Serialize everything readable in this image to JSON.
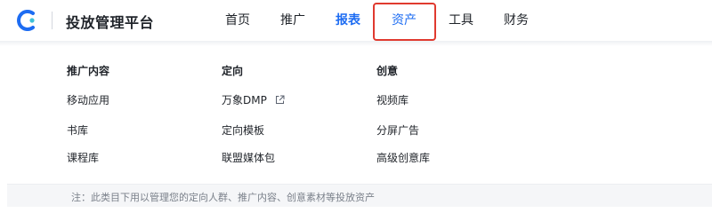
{
  "app": {
    "title": "投放管理平台"
  },
  "nav": {
    "items": [
      {
        "label": "首页"
      },
      {
        "label": "推广"
      },
      {
        "label": "报表"
      },
      {
        "label": "资产"
      },
      {
        "label": "工具"
      },
      {
        "label": "财务"
      }
    ],
    "active_index": 2,
    "highlighted_index": 3
  },
  "menu": {
    "columns": [
      {
        "title": "推广内容",
        "items": [
          "移动应用",
          "书库",
          "课程库"
        ]
      },
      {
        "title": "定向",
        "items": [
          "万象DMP",
          "定向模板",
          "联盟媒体包"
        ]
      },
      {
        "title": "创意",
        "items": [
          "视频库",
          "分屏广告",
          "高级创意库"
        ]
      }
    ]
  },
  "footer": {
    "note": "注：此类目下用以管理您的定向人群、推广内容、创意素材等投放资产"
  },
  "icons": {
    "logo": "brand-c-icon",
    "external": "external-link-icon"
  },
  "colors": {
    "accent": "#1d6cf2",
    "highlight_box": "#e03a2f",
    "text": "#1f2329",
    "muted": "#7a808a"
  }
}
